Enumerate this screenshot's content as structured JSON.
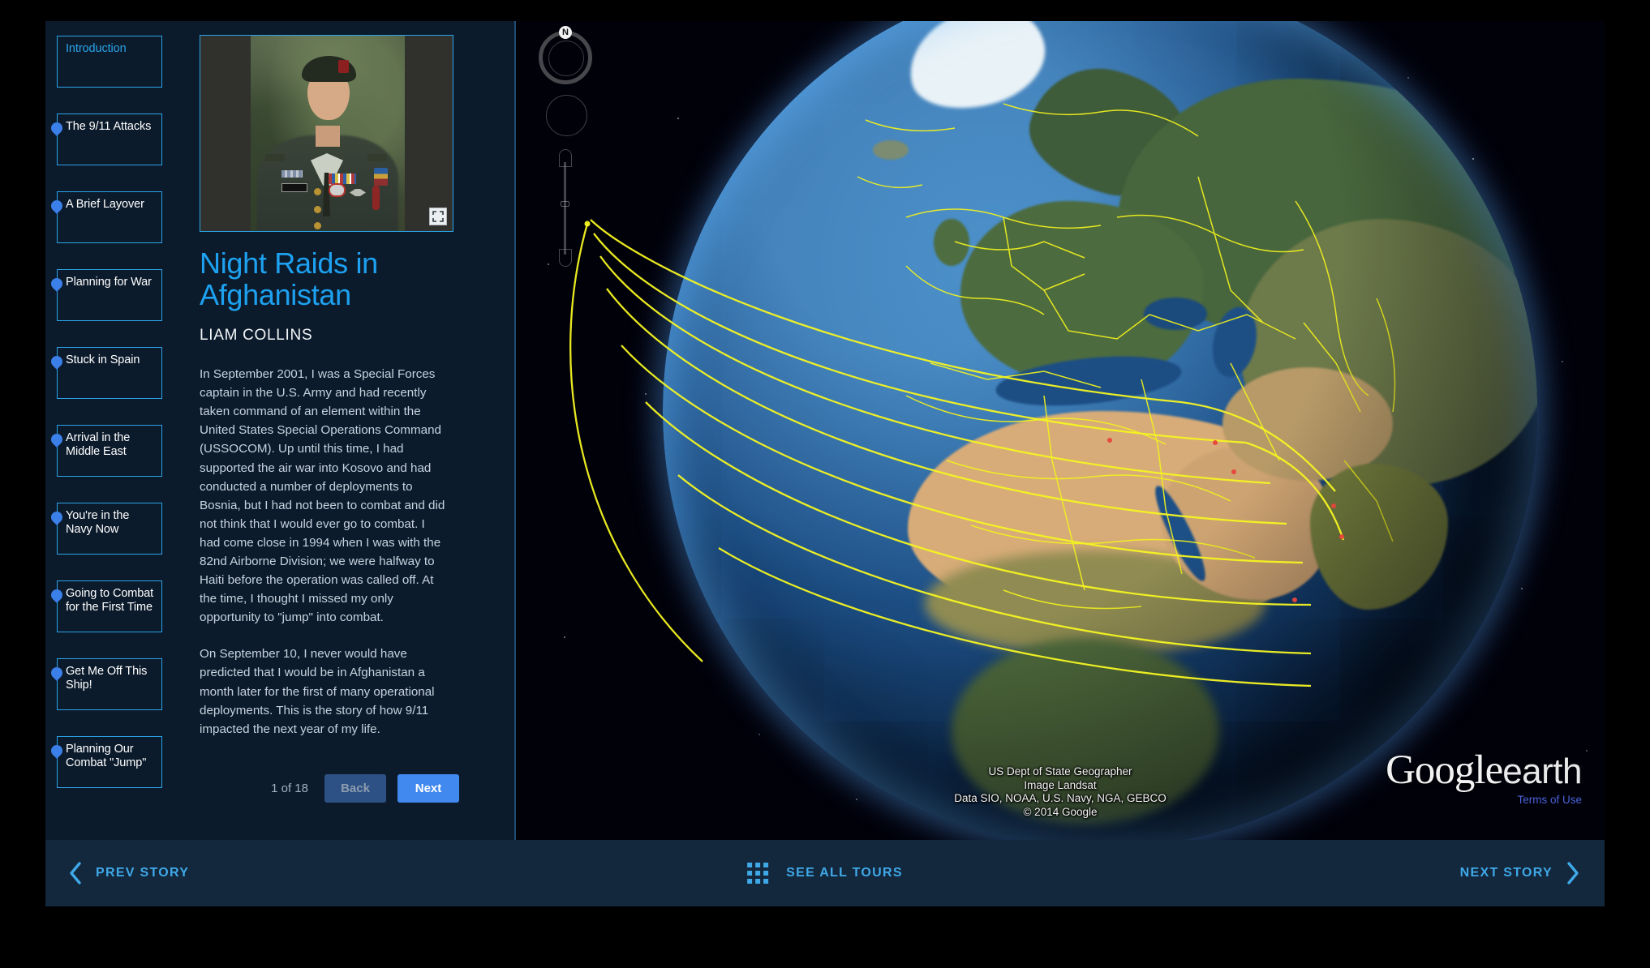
{
  "chapters": [
    {
      "label": "Introduction",
      "active": true
    },
    {
      "label": "The 9/11 Attacks",
      "active": false
    },
    {
      "label": "A Brief Layover",
      "active": false
    },
    {
      "label": "Planning for War",
      "active": false
    },
    {
      "label": "Stuck in Spain",
      "active": false
    },
    {
      "label": "Arrival in the Middle East",
      "active": false
    },
    {
      "label": "You're in the Navy Now",
      "active": false
    },
    {
      "label": "Going to Combat for the First Time",
      "active": false
    },
    {
      "label": "Get Me Off This Ship!",
      "active": false
    },
    {
      "label": "Planning Our Combat \"Jump\"",
      "active": false
    }
  ],
  "story": {
    "title": "Night Raids in Afghanistan",
    "author": "LIAM COLLINS",
    "paragraph1": "In September 2001, I was a Special Forces captain in the U.S. Army and had recently taken command of an element within the United States Special Operations Command (USSOCOM). Up until this time, I had supported the air war into Kosovo and had conducted a number of deployments to Bosnia, but I had not been to combat and did not think that I would ever go to combat. I had come close in 1994 when I was with the 82nd Airborne Division; we were halfway to Haiti before the operation was called off. At the time, I thought I missed my only opportunity to \"jump\" into combat.",
    "paragraph2": "On September 10, I never would have predicted that I would be in Afghanistan a month later for the first of many operational deployments. This is the story of how 9/11 impacted the next year of my life.",
    "photo_alt": "Portrait of Liam Collins in US Army dress uniform with green beret"
  },
  "pager": {
    "count": "1 of 18",
    "back_label": "Back",
    "next_label": "Next"
  },
  "map": {
    "compass_north": "N",
    "attribution_line1": "US Dept of State Geographer",
    "attribution_line2": "Image Landsat",
    "attribution_line3": "Data SIO, NOAA, U.S. Navy, NGA, GEBCO",
    "attribution_line4": "© 2014 Google",
    "logo_google": "Google",
    "logo_earth": "earth",
    "terms_label": "Terms of Use"
  },
  "bottom_bar": {
    "prev_label": "PREV STORY",
    "see_all_label": "SEE ALL TOURS",
    "next_label": "NEXT STORY"
  },
  "colors": {
    "accent": "#2aa3e8",
    "title": "#1da1f0",
    "panel_bg": "#0c1b2c",
    "bottom_bar_bg": "#13273d",
    "next_button": "#4189ef",
    "back_button": "#2d5184",
    "pin": "#3b7fe8",
    "arc": "#f5f522",
    "terms": "#4b63d8"
  }
}
